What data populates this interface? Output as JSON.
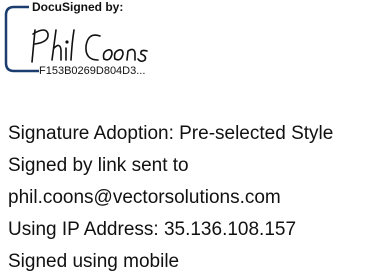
{
  "signature_block": {
    "header_label": "DocuSigned by:",
    "signer_name_script": "Phil Coons",
    "envelope_id": "F153B0269D804D3...",
    "frame_color": "#1a3c6e"
  },
  "details": {
    "lines": [
      "Signature Adoption: Pre-selected Style",
      "Signed by link sent to",
      "phil.coons@vectorsolutions.com",
      "Using IP Address: 35.136.108.157",
      "Signed using mobile"
    ]
  }
}
